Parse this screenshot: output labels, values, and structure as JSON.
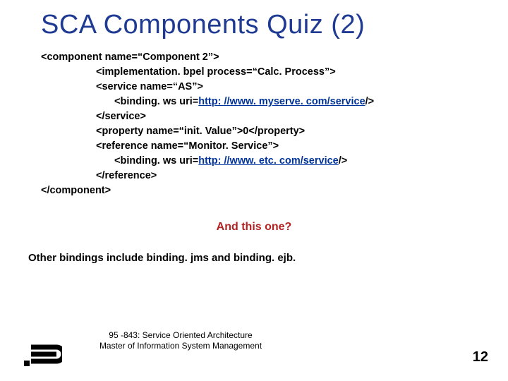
{
  "title": "SCA Components Quiz (2)",
  "code": {
    "l1": "<component name=“Component 2”>",
    "l2_pre": "<implementation. bpel process=“Calc. Process”>",
    "l3": "<service name=“AS”>",
    "l4_pre": "<binding. ws uri=",
    "l4_link": "http: //www. myserve. com/service",
    "l4_post": "/>",
    "l5": "</service>",
    "l6": "<property name=“init. Value”>0</property>",
    "l7": "<reference name=“Monitor. Service”>",
    "l8_pre": "<binding. ws uri=",
    "l8_link": "http: //www. etc. com/service",
    "l8_post": "/>",
    "l9": "</reference>",
    "l10": "</component>"
  },
  "question": "And this one?",
  "other": "Other bindings include binding. jms and binding. ejb.",
  "footer": {
    "line1": "95 -843: Service Oriented Architecture",
    "line2": "Master of Information System Management"
  },
  "page": "12"
}
